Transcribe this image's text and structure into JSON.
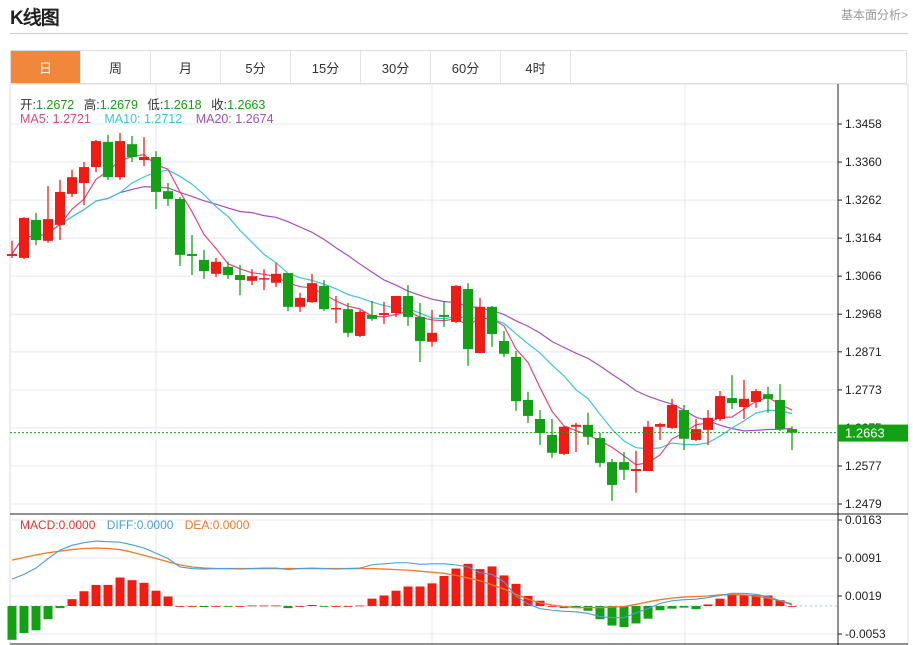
{
  "header": {
    "title": "K线图",
    "link": "基本面分析>"
  },
  "tabs": [
    {
      "label": "日",
      "active": true
    },
    {
      "label": "周"
    },
    {
      "label": "月"
    },
    {
      "label": "5分"
    },
    {
      "label": "15分"
    },
    {
      "label": "30分"
    },
    {
      "label": "60分"
    },
    {
      "label": "4时"
    }
  ],
  "ohlc_info": {
    "open_label": "开:",
    "open": "1.2672",
    "high_label": "高:",
    "high": "1.2679",
    "low_label": "低:",
    "low": "1.2618",
    "close_label": "收:",
    "close": "1.2663"
  },
  "ma_info": {
    "ma5": "MA5: 1.2721",
    "ma10": "MA10: 1.2712",
    "ma20": "MA20: 1.2674"
  },
  "macd_info": {
    "macd": "MACD:0.0000",
    "diff": "DIFF:0.0000",
    "dea": "DEA:0.0000"
  },
  "colors": {
    "up": "#f01c14",
    "down": "#14a014",
    "ma5": "#e2487e",
    "ma10": "#3ec4d6",
    "ma20": "#a64fc0",
    "diff": "#4a9de0",
    "dea": "#f07a28",
    "accent": "#f0873a"
  },
  "chart_data": [
    {
      "type": "candlestick",
      "price_ticks": [
        "1.3458",
        "1.3360",
        "1.3262",
        "1.3164",
        "1.3066",
        "1.2968",
        "1.2871",
        "1.2773",
        "1.2675",
        "1.2577",
        "1.2479"
      ],
      "ylim": [
        1.2479,
        1.3458
      ],
      "current_price": "1.2663",
      "ohlc": [
        [
          1.3118,
          1.3157,
          1.3113,
          1.3123
        ],
        [
          1.3113,
          1.3218,
          1.311,
          1.3216
        ],
        [
          1.3211,
          1.3229,
          1.3146,
          1.3159
        ],
        [
          1.3157,
          1.3298,
          1.3152,
          1.3213
        ],
        [
          1.3198,
          1.3314,
          1.3159,
          1.3283
        ],
        [
          1.3278,
          1.334,
          1.327,
          1.3321
        ],
        [
          1.3306,
          1.336,
          1.3249,
          1.3347
        ],
        [
          1.3347,
          1.3417,
          1.3334,
          1.3414
        ],
        [
          1.3412,
          1.343,
          1.3314,
          1.3321
        ],
        [
          1.3321,
          1.3435,
          1.3314,
          1.3414
        ],
        [
          1.3406,
          1.3427,
          1.336,
          1.3373
        ],
        [
          1.3365,
          1.3424,
          1.335,
          1.3373
        ],
        [
          1.3373,
          1.3388,
          1.3239,
          1.3283
        ],
        [
          1.3285,
          1.3306,
          1.3247,
          1.3265
        ],
        [
          1.3265,
          1.327,
          1.3092,
          1.3121
        ],
        [
          1.3123,
          1.3172,
          1.3069,
          1.3118
        ],
        [
          1.3108,
          1.3134,
          1.3059,
          1.3079
        ],
        [
          1.3072,
          1.3113,
          1.3064,
          1.3103
        ],
        [
          1.309,
          1.3103,
          1.3059,
          1.3069
        ],
        [
          1.3069,
          1.3095,
          1.3017,
          1.3056
        ],
        [
          1.3054,
          1.3084,
          1.3043,
          1.3066
        ],
        [
          1.3059,
          1.3084,
          1.303,
          1.3061
        ],
        [
          1.3049,
          1.31,
          1.3038,
          1.3072
        ],
        [
          1.3074,
          1.3074,
          1.2976,
          1.2987
        ],
        [
          1.2987,
          1.3023,
          1.2974,
          1.301
        ],
        [
          1.2999,
          1.3072,
          1.2997,
          1.3048
        ],
        [
          1.3041,
          1.3056,
          1.2976,
          1.2981
        ],
        [
          1.2981,
          1.3015,
          1.2945,
          1.2984
        ],
        [
          1.2981,
          1.2997,
          1.2909,
          1.292
        ],
        [
          1.2912,
          1.2979,
          1.2909,
          1.2974
        ],
        [
          1.2966,
          1.3002,
          1.2951,
          1.2956
        ],
        [
          1.2966,
          1.3,
          1.2943,
          1.2971
        ],
        [
          1.2971,
          1.3015,
          1.2961,
          1.3015
        ],
        [
          1.3015,
          1.3043,
          1.2938,
          1.2961
        ],
        [
          1.2961,
          1.2997,
          1.2845,
          1.2899
        ],
        [
          1.2897,
          1.2979,
          1.2884,
          1.292
        ],
        [
          1.2966,
          1.3002,
          1.2935,
          1.2961
        ],
        [
          1.2948,
          1.3043,
          1.2945,
          1.3041
        ],
        [
          1.3033,
          1.3048,
          1.2835,
          1.2878
        ],
        [
          1.2868,
          1.301,
          1.2868,
          1.2987
        ],
        [
          1.2987,
          1.2989,
          1.2884,
          1.2917
        ],
        [
          1.2899,
          1.2925,
          1.2858,
          1.2866
        ],
        [
          1.2858,
          1.2873,
          1.2719,
          1.2744
        ],
        [
          1.2747,
          1.2768,
          1.2688,
          1.2706
        ],
        [
          1.2698,
          1.2721,
          1.2631,
          1.2662
        ],
        [
          1.2657,
          1.2698,
          1.2598,
          1.2611
        ],
        [
          1.2608,
          1.268,
          1.2605,
          1.2678
        ],
        [
          1.2678,
          1.2688,
          1.2613,
          1.2683
        ],
        [
          1.2683,
          1.2714,
          1.2631,
          1.2652
        ],
        [
          1.2649,
          1.2662,
          1.2574,
          1.2585
        ],
        [
          1.2587,
          1.2595,
          1.2487,
          1.2528
        ],
        [
          1.2587,
          1.2613,
          1.2541,
          1.2567
        ],
        [
          1.2564,
          1.2616,
          1.2508,
          1.2569
        ],
        [
          1.2564,
          1.2693,
          1.2564,
          1.2678
        ],
        [
          1.2678,
          1.2688,
          1.2644,
          1.2685
        ],
        [
          1.2675,
          1.275,
          1.2672,
          1.2734
        ],
        [
          1.2721,
          1.2734,
          1.2618,
          1.2647
        ],
        [
          1.2644,
          1.2698,
          1.2641,
          1.2672
        ],
        [
          1.267,
          1.2721,
          1.2631,
          1.2701
        ],
        [
          1.2698,
          1.277,
          1.2693,
          1.2757
        ],
        [
          1.2752,
          1.2811,
          1.2724,
          1.2739
        ],
        [
          1.2729,
          1.2799,
          1.2698,
          1.275
        ],
        [
          1.2742,
          1.2775,
          1.2727,
          1.277
        ],
        [
          1.2762,
          1.2781,
          1.2714,
          1.275
        ],
        [
          1.2747,
          1.2788,
          1.2667,
          1.2672
        ],
        [
          1.2672,
          1.2679,
          1.2618,
          1.2663
        ]
      ]
    },
    {
      "type": "bar+line",
      "name": "MACD",
      "ticks": [
        "0.0163",
        "0.0091",
        "0.0019",
        "-0.0053"
      ],
      "ylim": [
        -0.0053,
        0.0163
      ],
      "macd": [
        -0.0064,
        -0.0051,
        -0.0046,
        -0.0025,
        -0.0004,
        0.0013,
        0.0028,
        0.004,
        0.004,
        0.0054,
        0.0049,
        0.0044,
        0.0029,
        0.0018,
        0,
        0,
        -0.0002,
        0,
        -0.0001,
        0,
        0.0001,
        0.0001,
        0.0001,
        -0.0004,
        0,
        0.0002,
        -0.0001,
        0,
        0,
        0.0001,
        0.0014,
        0.002,
        0.0029,
        0.0037,
        0.0037,
        0.0043,
        0.0057,
        0.0071,
        0.008,
        0.007,
        0.0075,
        0.0058,
        0.0042,
        0.0019,
        0.001,
        0,
        -0.0004,
        -0.0004,
        -0.0009,
        -0.0025,
        -0.0037,
        -0.004,
        -0.0033,
        -0.0024,
        -0.0008,
        -0.0005,
        -0.0003,
        -0.0006,
        0.0003,
        0.0014,
        0.0021,
        0.002,
        0.0021,
        0.002,
        0.0011,
        0
      ],
      "diff": [
        0.0051,
        0.006,
        0.0072,
        0.009,
        0.0106,
        0.0115,
        0.012,
        0.0123,
        0.0122,
        0.0121,
        0.0116,
        0.011,
        0.01,
        0.009,
        0.0074,
        0.0071,
        0.007,
        0.0071,
        0.0071,
        0.007,
        0.0071,
        0.0072,
        0.0072,
        0.0069,
        0.0071,
        0.0072,
        0.0071,
        0.007,
        0.0071,
        0.0072,
        0.0078,
        0.008,
        0.0082,
        0.0082,
        0.0079,
        0.008,
        0.008,
        0.0078,
        0.0074,
        0.0063,
        0.006,
        0.0046,
        0.0019,
        0.0004,
        -0.0005,
        -0.0008,
        -0.001,
        -0.0011,
        -0.0014,
        -0.002,
        -0.0022,
        -0.0022,
        -0.0013,
        -0.0005,
        0.0005,
        0.001,
        0.0012,
        0.0013,
        0.0016,
        0.002,
        0.0024,
        0.0024,
        0.0022,
        0.0018,
        0.001,
        0.0002
      ],
      "dea": [
        0.0087,
        0.0092,
        0.0097,
        0.0101,
        0.0104,
        0.0107,
        0.0109,
        0.011,
        0.0109,
        0.0107,
        0.0102,
        0.0096,
        0.009,
        0.0084,
        0.0078,
        0.0074,
        0.0072,
        0.0071,
        0.0071,
        0.0071,
        0.0071,
        0.0071,
        0.0071,
        0.0071,
        0.0071,
        0.0071,
        0.0071,
        0.0071,
        0.0071,
        0.0071,
        0.0071,
        0.007,
        0.0069,
        0.0068,
        0.0066,
        0.0064,
        0.0062,
        0.0058,
        0.0053,
        0.0048,
        0.004,
        0.0032,
        0.0022,
        0.0013,
        0.0006,
        0.0002,
        -0.0001,
        -0.0003,
        -0.0003,
        -0.0003,
        -0.0002,
        -0.0001,
        0.0003,
        0.0008,
        0.0012,
        0.0015,
        0.0017,
        0.0018,
        0.0019,
        0.0021,
        0.0022,
        0.0021,
        0.0019,
        0.0015,
        0.001,
        0.0004
      ]
    }
  ]
}
